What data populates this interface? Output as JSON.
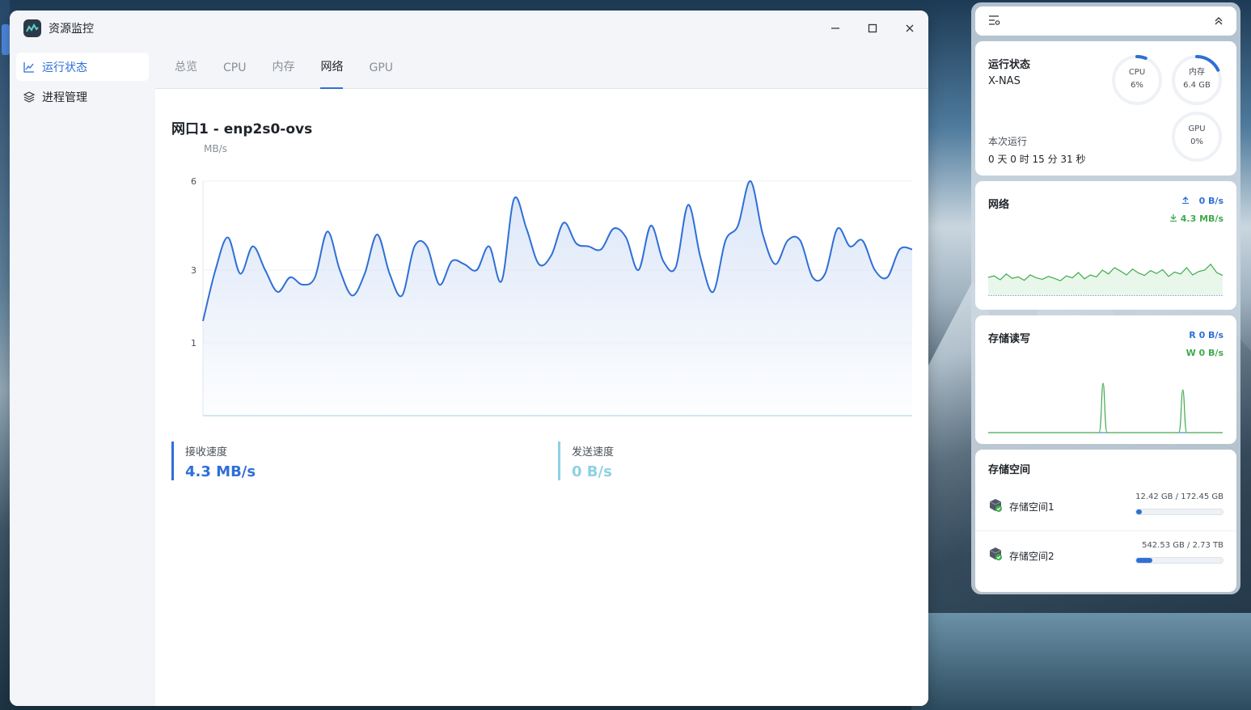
{
  "window": {
    "title": "资源监控",
    "controls": {
      "minimize": "—",
      "maximize": "☐",
      "close": "✕"
    }
  },
  "sidebar": {
    "items": [
      {
        "label": "运行状态",
        "icon": "line-chart-icon",
        "active": true
      },
      {
        "label": "进程管理",
        "icon": "layers-icon",
        "active": false
      }
    ]
  },
  "tabs": [
    {
      "label": "总览",
      "active": false
    },
    {
      "label": "CPU",
      "active": false
    },
    {
      "label": "内存",
      "active": false
    },
    {
      "label": "网络",
      "active": true
    },
    {
      "label": "GPU",
      "active": false
    }
  ],
  "network": {
    "interface_title": "网口1 - enp2s0-ovs",
    "receive": {
      "label": "接收速度",
      "value": "4.3 MB/s"
    },
    "send": {
      "label": "发送速度",
      "value": "0 B/s"
    }
  },
  "chart_data": {
    "type": "area",
    "title": "",
    "xlabel": "",
    "ylabel": "MB/s",
    "yticks": [
      1,
      3,
      6
    ],
    "ylim": [
      0,
      6
    ],
    "grid": true,
    "colors": {
      "line": "#2f6fd6",
      "fill": "#dbe6f8"
    },
    "values": [
      1.6,
      3.0,
      4.1,
      2.9,
      3.8,
      3.0,
      2.4,
      2.8,
      2.6,
      2.8,
      4.3,
      3.0,
      2.3,
      2.9,
      4.2,
      2.9,
      2.3,
      3.8,
      3.8,
      2.6,
      3.3,
      3.2,
      3.0,
      3.8,
      2.7,
      5.4,
      4.4,
      3.2,
      3.5,
      4.6,
      3.9,
      3.8,
      3.7,
      4.4,
      4.1,
      3.0,
      4.5,
      3.3,
      3.1,
      5.2,
      3.4,
      2.4,
      4.0,
      4.5,
      6.0,
      4.2,
      3.2,
      4.0,
      4.0,
      2.8,
      2.9,
      4.4,
      3.8,
      4.0,
      3.0,
      2.8,
      3.7,
      3.7
    ]
  },
  "widgets": {
    "status": {
      "title": "运行状态",
      "host": "X-NAS",
      "uptime_label": "本次运行",
      "uptime": "0 天 0 时 15 分 31 秒",
      "cpu": {
        "label": "CPU",
        "value": "6%",
        "fraction": 0.06
      },
      "memory": {
        "label": "内存",
        "value": "6.4 GB",
        "fraction": 0.18
      },
      "gpu": {
        "label": "GPU",
        "value": "0%",
        "fraction": 0
      }
    },
    "network": {
      "title": "网络",
      "upload": "0 B/s",
      "download": "4.3 MB/s",
      "sparkline": [
        0.35,
        0.38,
        0.3,
        0.42,
        0.33,
        0.36,
        0.29,
        0.4,
        0.34,
        0.31,
        0.37,
        0.33,
        0.28,
        0.38,
        0.34,
        0.45,
        0.32,
        0.4,
        0.36,
        0.5,
        0.42,
        0.55,
        0.48,
        0.4,
        0.52,
        0.44,
        0.39,
        0.49,
        0.43,
        0.51,
        0.37,
        0.46,
        0.42,
        0.55,
        0.4,
        0.47,
        0.5,
        0.62,
        0.45,
        0.39
      ]
    },
    "storage_io": {
      "title": "存储读写",
      "read": "R  0 B/s",
      "write": "W  0 B/s",
      "spikes": [
        0.49,
        0.83
      ]
    },
    "storage_space": {
      "title": "存储空间",
      "volumes": [
        {
          "name": "存储空间1",
          "usage": "12.42 GB / 172.45 GB",
          "fraction": 0.07
        },
        {
          "name": "存储空间2",
          "usage": "542.53 GB / 2.73 TB",
          "fraction": 0.19
        }
      ]
    }
  }
}
